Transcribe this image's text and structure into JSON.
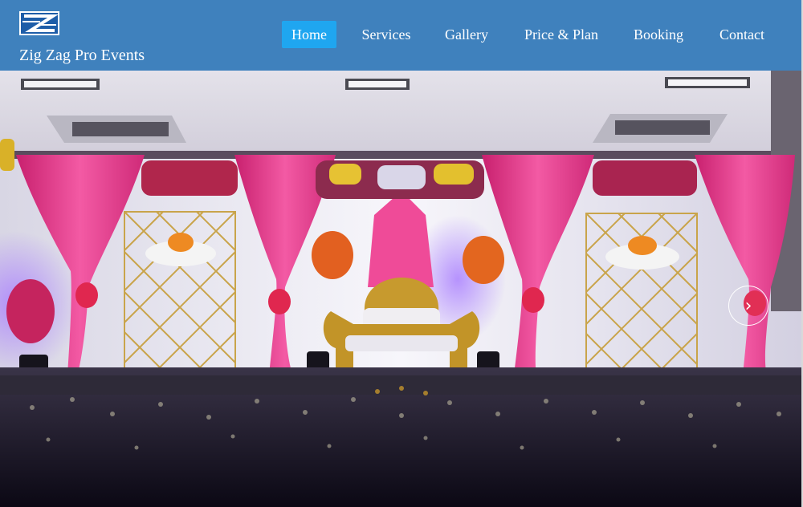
{
  "brand": {
    "name": "Zig Zag Pro Events",
    "logo_icon": "zigzag-logo-icon"
  },
  "nav": {
    "items": [
      {
        "label": "Home",
        "active": true
      },
      {
        "label": "Services",
        "active": false
      },
      {
        "label": "Gallery",
        "active": false
      },
      {
        "label": "Price & Plan",
        "active": false
      },
      {
        "label": "Booking",
        "active": false
      },
      {
        "label": "Contact",
        "active": false
      }
    ]
  },
  "hero": {
    "image": "wedding-stage-decoration-photo",
    "next_icon": "chevron-right-icon",
    "next_glyph": "›"
  },
  "colors": {
    "navbar": "#3f81bd",
    "nav_active": "#1fa6f0",
    "text": "#ffffff"
  }
}
